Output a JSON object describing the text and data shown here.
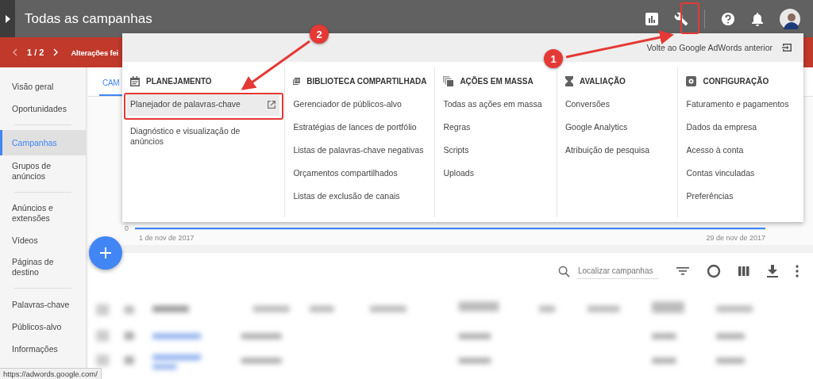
{
  "top_bar": {
    "title": "Todas as campanhas"
  },
  "notice_bar": {
    "pager": "1 / 2",
    "message": "Alterações fei"
  },
  "sidebar": {
    "groups": [
      [
        {
          "label": "Visão geral",
          "selected": false
        },
        {
          "label": "Oportunidades",
          "selected": false
        }
      ],
      [
        {
          "label": "Campanhas",
          "selected": true
        },
        {
          "label": "Grupos de anúncios",
          "selected": false
        }
      ],
      [
        {
          "label": "Anúncios e extensões",
          "selected": false
        },
        {
          "label": "Vídeos",
          "selected": false
        },
        {
          "label": "Páginas de destino",
          "selected": false
        }
      ],
      [
        {
          "label": "Palavras-chave",
          "selected": false
        },
        {
          "label": "Públicos-alvo",
          "selected": false
        },
        {
          "label": "Informações",
          "selected": false
        }
      ]
    ]
  },
  "tabs": [
    {
      "label": "CAM",
      "selected": true
    }
  ],
  "chart": {
    "y_label": "0",
    "start_date": "1 de nov de 2017",
    "end_date": "29 de nov de 2017"
  },
  "tools_menu": {
    "back_link": "Volte ao Google AdWords anterior",
    "columns": [
      {
        "title": "PLANEJAMENTO",
        "items": [
          {
            "label": "Planejador de palavras-chave",
            "highlighted": true,
            "external": true
          },
          {
            "label": "Diagnóstico e visualização de anúncios",
            "highlighted": false,
            "external": false
          }
        ]
      },
      {
        "title": "BIBLIOTECA COMPARTILHADA",
        "items": [
          {
            "label": "Gerenciador de públicos-alvo",
            "highlighted": false,
            "external": false
          },
          {
            "label": "Estratégias de lances de portfólio",
            "highlighted": false,
            "external": false
          },
          {
            "label": "Listas de palavras-chave negativas",
            "highlighted": false,
            "external": false
          },
          {
            "label": "Orçamentos compartilhados",
            "highlighted": false,
            "external": false
          },
          {
            "label": "Listas de exclusão de canais",
            "highlighted": false,
            "external": false
          }
        ]
      },
      {
        "title": "AÇÕES EM MASSA",
        "items": [
          {
            "label": "Todas as ações em massa",
            "highlighted": false,
            "external": false
          },
          {
            "label": "Regras",
            "highlighted": false,
            "external": false
          },
          {
            "label": "Scripts",
            "highlighted": false,
            "external": false
          },
          {
            "label": "Uploads",
            "highlighted": false,
            "external": false
          }
        ]
      },
      {
        "title": "AVALIAÇÃO",
        "items": [
          {
            "label": "Conversões",
            "highlighted": false,
            "external": false
          },
          {
            "label": "Google Analytics",
            "highlighted": false,
            "external": false
          },
          {
            "label": "Atribuição de pesquisa",
            "highlighted": false,
            "external": false
          }
        ]
      },
      {
        "title": "CONFIGURAÇÃO",
        "items": [
          {
            "label": "Faturamento e pagamentos",
            "highlighted": false,
            "external": false
          },
          {
            "label": "Dados da empresa",
            "highlighted": false,
            "external": false
          },
          {
            "label": "Acesso à conta",
            "highlighted": false,
            "external": false
          },
          {
            "label": "Contas vinculadas",
            "highlighted": false,
            "external": false
          },
          {
            "label": "Preferências",
            "highlighted": false,
            "external": false
          }
        ]
      }
    ]
  },
  "table_toolbar": {
    "search": {
      "placeholder": "Localizar campanhas"
    }
  },
  "annotations": [
    {
      "number": "1"
    },
    {
      "number": "2"
    }
  ],
  "status_bar": {
    "url": "https://adwords.google.com/"
  }
}
